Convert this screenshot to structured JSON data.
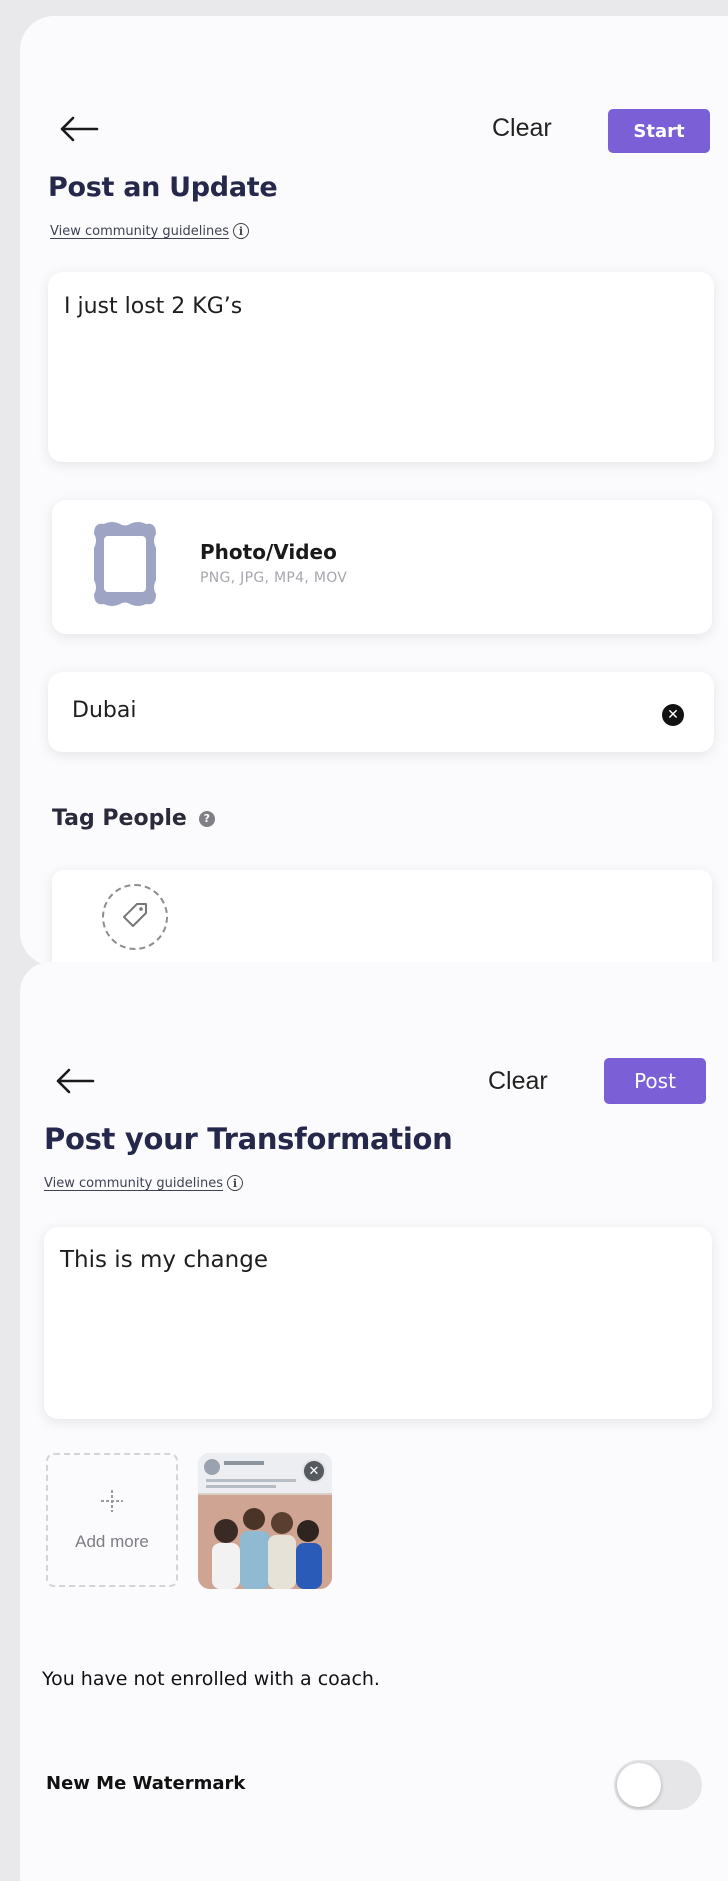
{
  "update_screen": {
    "clear_label": "Clear",
    "start_label": "Start",
    "title": "Post an Update",
    "guidelines_link": "View community guidelines",
    "post_text": "I just lost 2 KG’s",
    "media": {
      "title": "Photo/Video",
      "formats": "PNG, JPG, MP4, MOV"
    },
    "location": "Dubai",
    "tag_people_label": "Tag People"
  },
  "transformation_screen": {
    "clear_label": "Clear",
    "post_label": "Post",
    "title": "Post your Transformation",
    "guidelines_link": "View community guidelines",
    "post_text": "This is my change",
    "add_more_label": "Add more",
    "coach_status": "You have not enrolled with a coach.",
    "watermark_label": "New Me Watermark",
    "watermark_enabled": false
  },
  "colors": {
    "accent": "#7b5fd6",
    "title": "#25284a",
    "frame_icon": "#9ea4c4",
    "background": "#e9e9eb"
  },
  "icons": [
    "back-arrow-icon",
    "info-icon",
    "picture-frame-icon",
    "clear-icon",
    "help-icon",
    "tag-icon",
    "plus-icon",
    "remove-icon"
  ]
}
